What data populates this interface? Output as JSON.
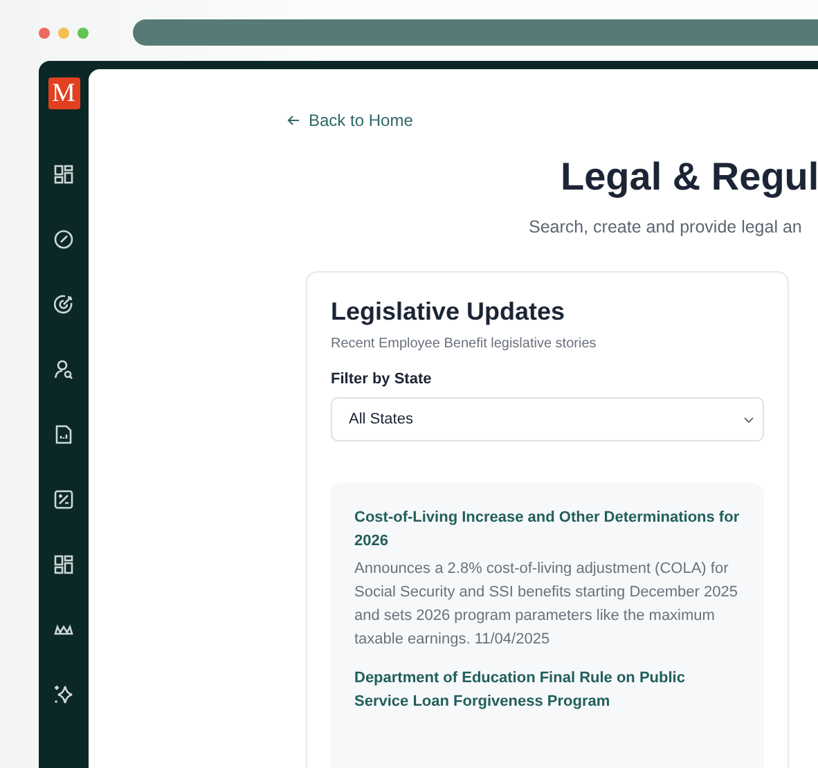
{
  "browser": {
    "window_controls": [
      {
        "color": "#ec6a5e"
      },
      {
        "color": "#f4bf4f"
      },
      {
        "color": "#61c554"
      }
    ]
  },
  "sidebar": {
    "logo": "M"
  },
  "back_link": "Back to Home",
  "page": {
    "title": "Legal & Regul",
    "subtitle": "Search, create and provide legal an"
  },
  "card": {
    "title": "Legislative Updates",
    "subtitle": "Recent Employee Benefit legislative stories",
    "filter_label": "Filter by State",
    "filter_value": "All States",
    "stories": [
      {
        "title": "Cost-of-Living Increase and Other Determinations for 2026",
        "summary": "Announces a 2.8% cost-of-living adjustment (COLA) for Social Security and SSI benefits starting December 2025 and sets 2026 program parameters like the maximum taxable earnings. 11/04/2025"
      },
      {
        "title": "Department of Education Final Rule on Public Service Loan Forgiveness Program"
      }
    ]
  }
}
